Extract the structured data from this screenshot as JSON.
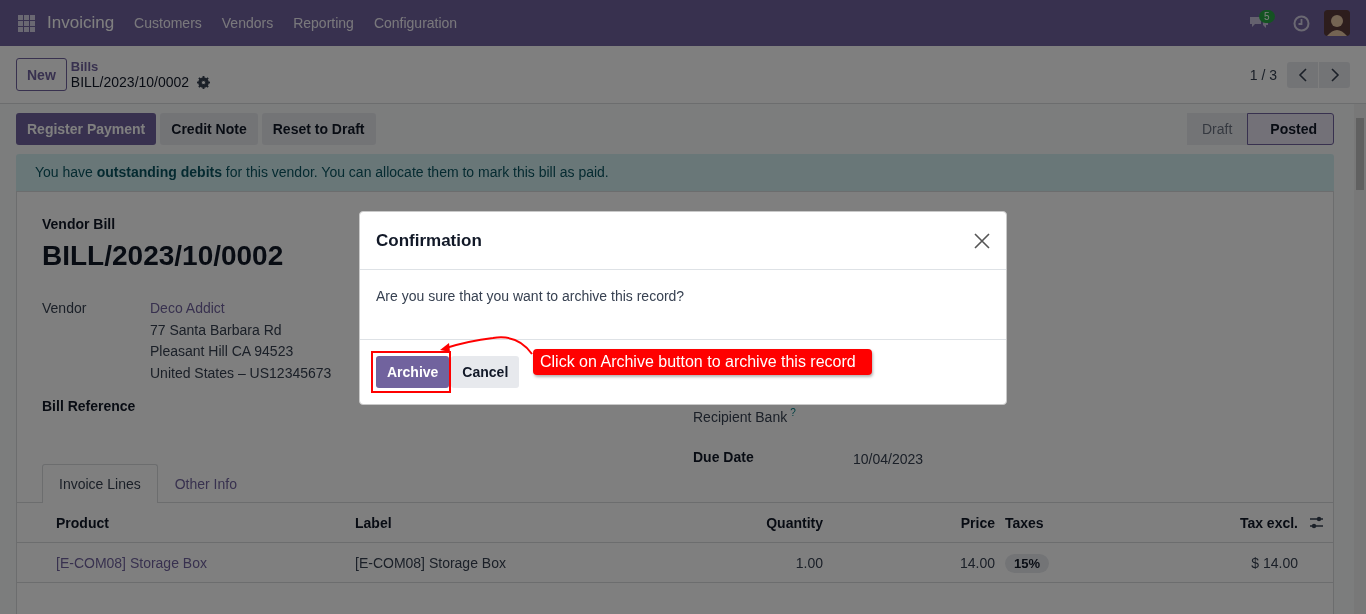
{
  "navbar": {
    "app": "Invoicing",
    "menu": [
      "Customers",
      "Vendors",
      "Reporting",
      "Configuration"
    ],
    "message_count": "5"
  },
  "control_panel": {
    "new_button": "New",
    "breadcrumb": "Bills",
    "record": "BILL/2023/10/0002",
    "pager": "1 / 3"
  },
  "action_buttons": [
    {
      "label": "Register Payment",
      "kind": "primary"
    },
    {
      "label": "Credit Note",
      "kind": "secondary"
    },
    {
      "label": "Reset to Draft",
      "kind": "secondary"
    }
  ],
  "status_steps": [
    {
      "label": "Draft",
      "selected": false
    },
    {
      "label": "Posted",
      "selected": true
    }
  ],
  "alert": "You have **outstanding debits** for this vendor. You can allocate them to mark this bill as paid.",
  "form": {
    "type_label": "Vendor Bill",
    "title": "BILL/2023/10/0002",
    "vendor_label": "Vendor",
    "vendor_name": "Deco Addict",
    "vendor_address": [
      "77 Santa Barbara Rd",
      "Pleasant Hill CA 94523",
      "United States – US12345673"
    ],
    "bill_reference_label": "Bill Reference",
    "recipient_bank_label": "Recipient Bank",
    "recipient_bank_help": "?",
    "due_date_label": "Due Date",
    "due_date": "10/04/2023"
  },
  "tabs": [
    {
      "label": "Invoice Lines",
      "selected": true
    },
    {
      "label": "Other Info",
      "selected": false
    }
  ],
  "table": {
    "columns": [
      {
        "label": "Product",
        "kind": "text"
      },
      {
        "label": "Label",
        "kind": "text"
      },
      {
        "label": "Quantity",
        "kind": "number"
      },
      {
        "label": "Price",
        "kind": "number"
      },
      {
        "label": "Taxes",
        "kind": "tags"
      },
      {
        "label": "Tax excl.",
        "kind": "number"
      }
    ],
    "rows": [
      {
        "cells": [
          "[E-COM08] Storage Box",
          "[E-COM08] Storage Box",
          "1.00",
          "14.00",
          [
            "15%"
          ],
          "$ 14.00"
        ]
      }
    ]
  },
  "dialog": {
    "title": "Confirmation",
    "message": "Are you sure that you want to archive this record?",
    "buttons": [
      {
        "label": "Archive",
        "kind": "primary"
      },
      {
        "label": "Cancel",
        "kind": "secondary"
      }
    ]
  },
  "annotation": {
    "text": "Click on Archive button to archive this record"
  }
}
